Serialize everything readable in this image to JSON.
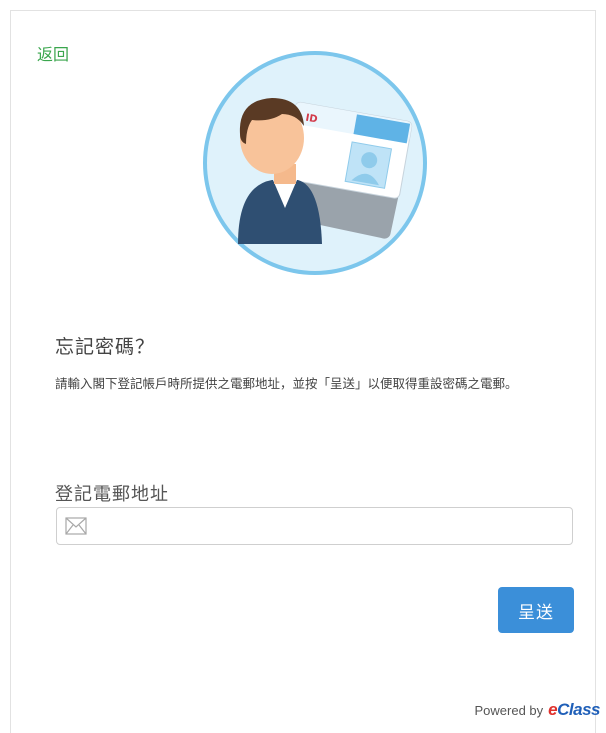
{
  "nav": {
    "back_label": "返回"
  },
  "form": {
    "title": "忘記密碼？",
    "description": "請輸入閣下登記帳戶時所提供之電郵地址，並按「呈送」以便取得重設密碼之電郵。",
    "email_label": "登記電郵地址",
    "email_value": "",
    "email_placeholder": "",
    "submit_label": "呈送"
  },
  "footer": {
    "powered_by": "Powered by",
    "brand_e": "e",
    "brand_rest": "Class"
  },
  "colors": {
    "link": "#3aa64d",
    "button": "#3b8fd9",
    "brand_red": "#e0312c",
    "brand_blue": "#1f5fb8"
  },
  "icons": {
    "illustration": "user-id-card-illustration",
    "email_field": "mail-icon"
  }
}
